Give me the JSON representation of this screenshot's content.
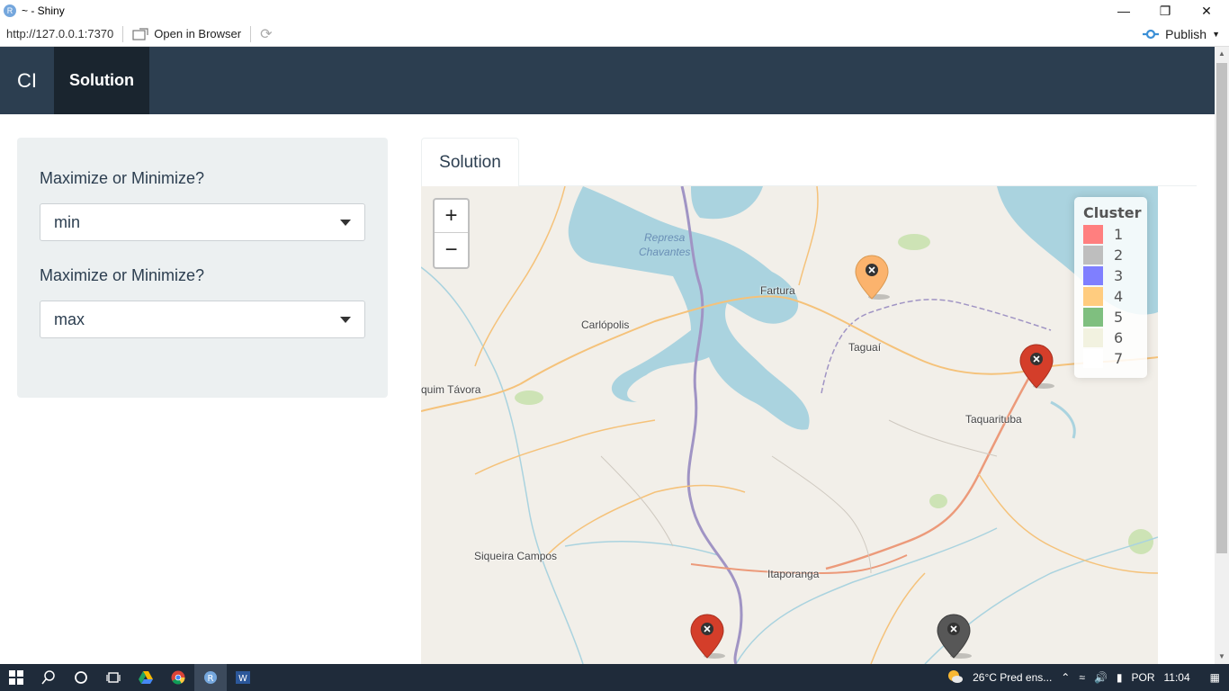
{
  "window": {
    "title": "~ - Shiny",
    "app_icon_letter": "R"
  },
  "viewer": {
    "url": "http://127.0.0.1:7370",
    "open_browser_label": "Open in Browser",
    "publish_label": "Publish"
  },
  "navbar": {
    "brand": "CI",
    "active_tab": "Solution"
  },
  "sidebar": {
    "inputs": [
      {
        "label": "Maximize or Minimize?",
        "value": "min"
      },
      {
        "label": "Maximize or Minimize?",
        "value": "max"
      }
    ]
  },
  "main": {
    "tab_label": "Solution",
    "zoom_in": "+",
    "zoom_out": "−"
  },
  "map": {
    "water_label_line1": "Represa",
    "water_label_line2": "Chavantes",
    "places": [
      "Fartura",
      "Carlópolis",
      "Taguaí",
      "quim Távora",
      "Taquarituba",
      "Siqueira Campos",
      "Itaporanga"
    ],
    "legend": {
      "title": "Cluster",
      "items": [
        {
          "label": "1",
          "color": "#ff7f7f"
        },
        {
          "label": "2",
          "color": "#bebebe"
        },
        {
          "label": "3",
          "color": "#7f7fff"
        },
        {
          "label": "4",
          "color": "#ffcc7f"
        },
        {
          "label": "5",
          "color": "#7fbf7f"
        },
        {
          "label": "6",
          "color": "#f2f2e0"
        },
        {
          "label": "7",
          "color": "#ffffff"
        }
      ]
    },
    "markers": [
      {
        "cluster": "4",
        "color": "#fbb36d"
      },
      {
        "cluster": "1",
        "color": "#d43e2a"
      },
      {
        "cluster": "1",
        "color": "#d43e2a"
      },
      {
        "cluster": "2",
        "color": "#575757"
      }
    ]
  },
  "taskbar": {
    "weather": "26°C  Pred ens...",
    "language": "POR",
    "time": "11:04"
  }
}
